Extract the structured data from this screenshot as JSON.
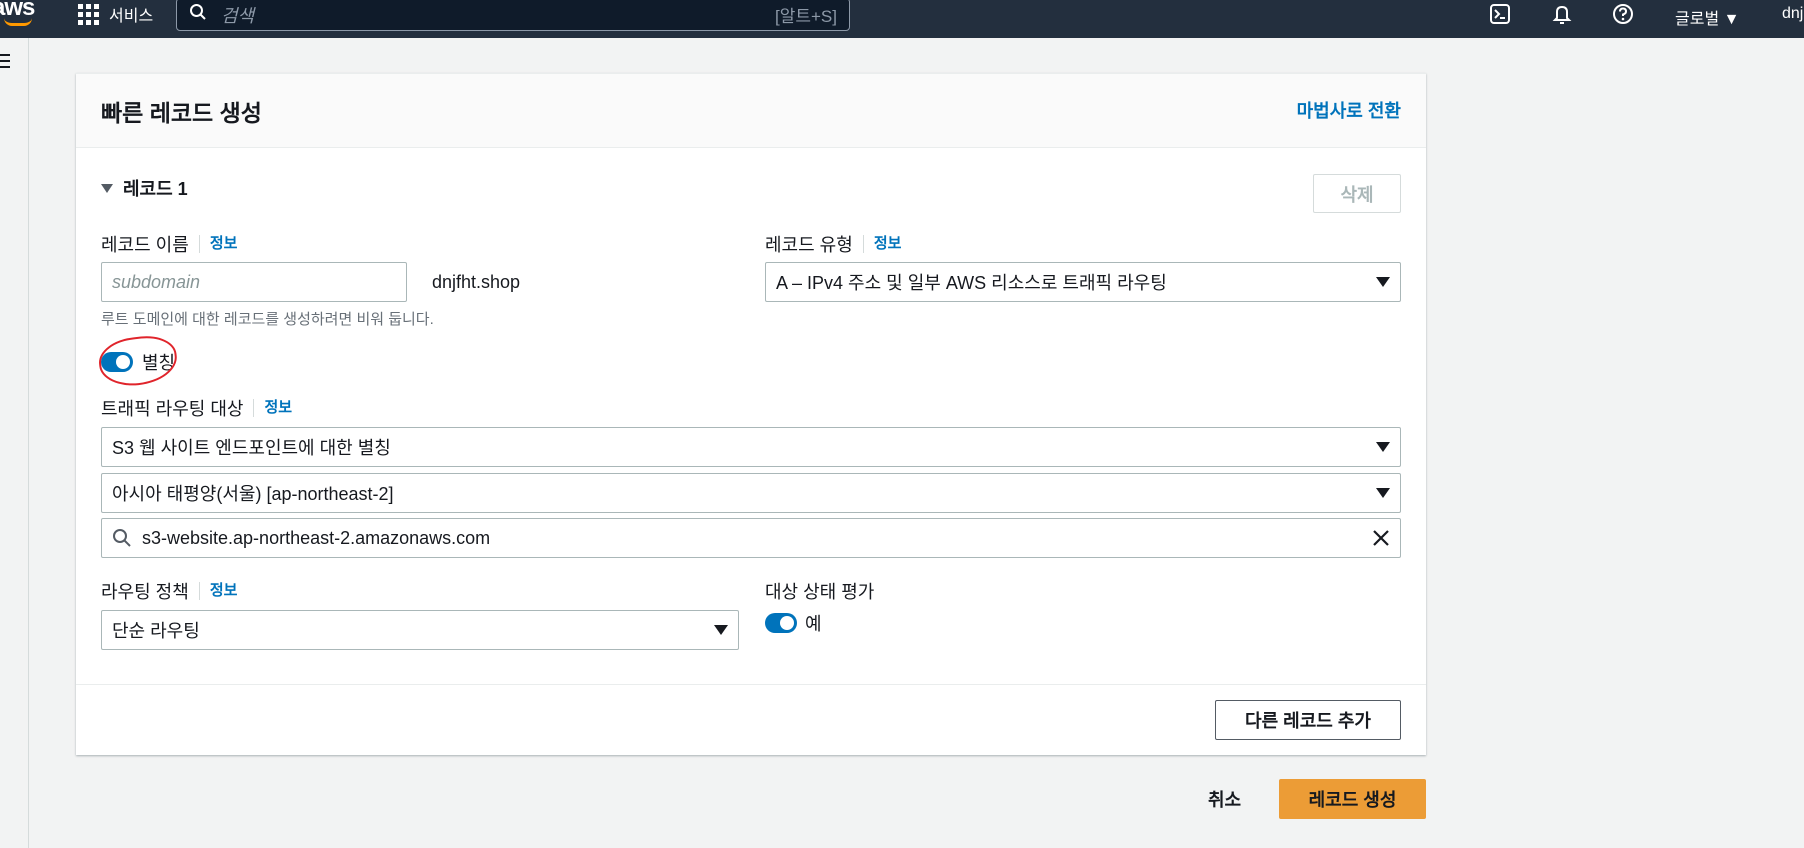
{
  "topnav": {
    "logo": "aws",
    "services_label": "서비스",
    "search_placeholder": "검색",
    "search_shortcut": "[알트+S]",
    "region_label": "글로벌 ▼",
    "user_label": "dnj",
    "icons": [
      "grid-icon",
      "search-icon",
      "cloudshell-icon",
      "bell-icon",
      "help-icon"
    ]
  },
  "card": {
    "title": "빠른 레코드 생성",
    "wizard_link": "마법사로 전환",
    "record_section": "레코드 1",
    "delete_label": "삭제",
    "record_name": {
      "label": "레코드 이름",
      "info": "정보",
      "placeholder": "subdomain",
      "suffix": "dnjfht.shop",
      "hint": "루트 도메인에 대한 레코드를 생성하려면 비워 둡니다."
    },
    "record_type": {
      "label": "레코드 유형",
      "info": "정보",
      "value": "A – IPv4 주소 및 일부 AWS 리소스로 트래픽 라우팅"
    },
    "alias": {
      "label": "별칭",
      "enabled": true
    },
    "traffic_target": {
      "label": "트래픽 라우팅 대상",
      "info": "정보",
      "endpoint_value": "S3 웹 사이트 엔드포인트에 대한 별칭",
      "region_value": "아시아 태평양(서울) [ap-northeast-2]",
      "search_value": "s3-website.ap-northeast-2.amazonaws.com"
    },
    "routing_policy": {
      "label": "라우팅 정책",
      "info": "정보",
      "value": "단순 라우팅"
    },
    "health": {
      "label": "대상 상태 평가",
      "toggle_label": "예",
      "enabled": true
    },
    "add_record_label": "다른 레코드 추가"
  },
  "actions": {
    "cancel_label": "취소",
    "create_label": "레코드 생성"
  },
  "colors": {
    "nav_bg": "#232f3e",
    "link": "#0073bb",
    "primary": "#ec9c36",
    "toggle": "#0073bb",
    "annotation": "#e0242b"
  }
}
